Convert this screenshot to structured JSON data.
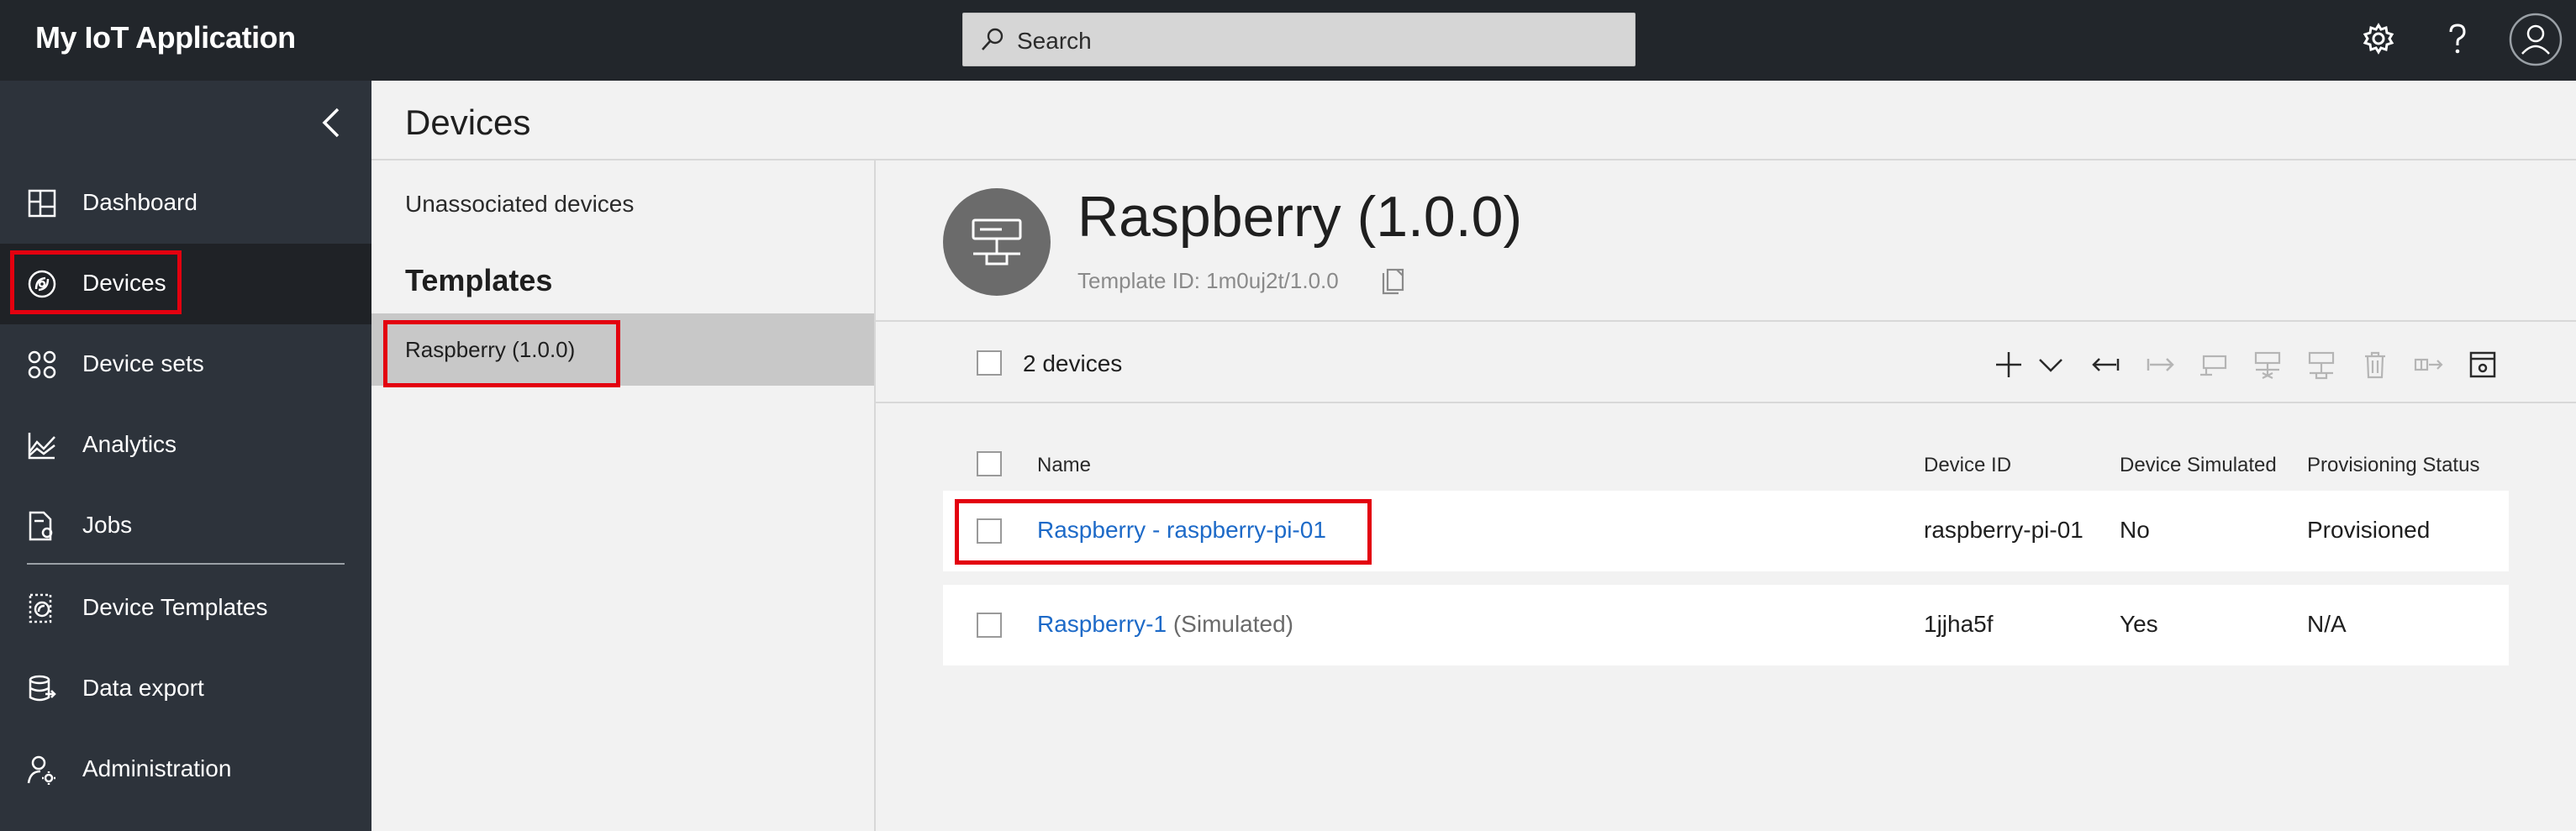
{
  "app": {
    "title": "My IoT Application"
  },
  "search": {
    "placeholder": "Search"
  },
  "topbar_icons": [
    "gear-icon",
    "help-icon",
    "user-avatar-icon"
  ],
  "sidebar": {
    "items": [
      {
        "label": "Dashboard",
        "icon": "dashboard-icon"
      },
      {
        "label": "Devices",
        "icon": "devices-icon",
        "selected": true
      },
      {
        "label": "Device sets",
        "icon": "device-sets-icon"
      },
      {
        "label": "Analytics",
        "icon": "analytics-icon"
      },
      {
        "label": "Jobs",
        "icon": "jobs-icon"
      },
      {
        "label": "Device Templates",
        "icon": "device-templates-icon"
      },
      {
        "label": "Data export",
        "icon": "data-export-icon"
      },
      {
        "label": "Administration",
        "icon": "administration-icon"
      }
    ]
  },
  "page": {
    "title": "Devices"
  },
  "templates_panel": {
    "unassociated": "Unassociated devices",
    "heading": "Templates",
    "items": [
      {
        "label": "Raspberry (1.0.0)",
        "selected": true
      }
    ]
  },
  "detail": {
    "title": "Raspberry (1.0.0)",
    "template_id": "Template ID: 1m0uj2t/1.0.0",
    "device_count": "2 devices",
    "toolbar_icons": [
      "add-icon",
      "chevron-down-icon",
      "arrow-left-icon",
      "arrow-right-icon",
      "device-icon",
      "device-disconnect-icon",
      "device-connect-icon",
      "delete-icon",
      "export-icon",
      "settings-panel-icon"
    ]
  },
  "table": {
    "columns": [
      "Name",
      "Device ID",
      "Device Simulated",
      "Provisioning Status"
    ],
    "rows": [
      {
        "name": "Raspberry - raspberry-pi-01",
        "suffix": "",
        "device_id": "raspberry-pi-01",
        "simulated": "No",
        "status": "Provisioned"
      },
      {
        "name": "Raspberry-1",
        "suffix": "(Simulated)",
        "device_id": "1jjha5f",
        "simulated": "Yes",
        "status": "N/A"
      }
    ]
  },
  "colors": {
    "topbar": "#22262b",
    "sidebar": "#2d333b",
    "sidebar_selected": "#1f2226",
    "link": "#1d6ac8",
    "highlight": "#e3000f"
  }
}
